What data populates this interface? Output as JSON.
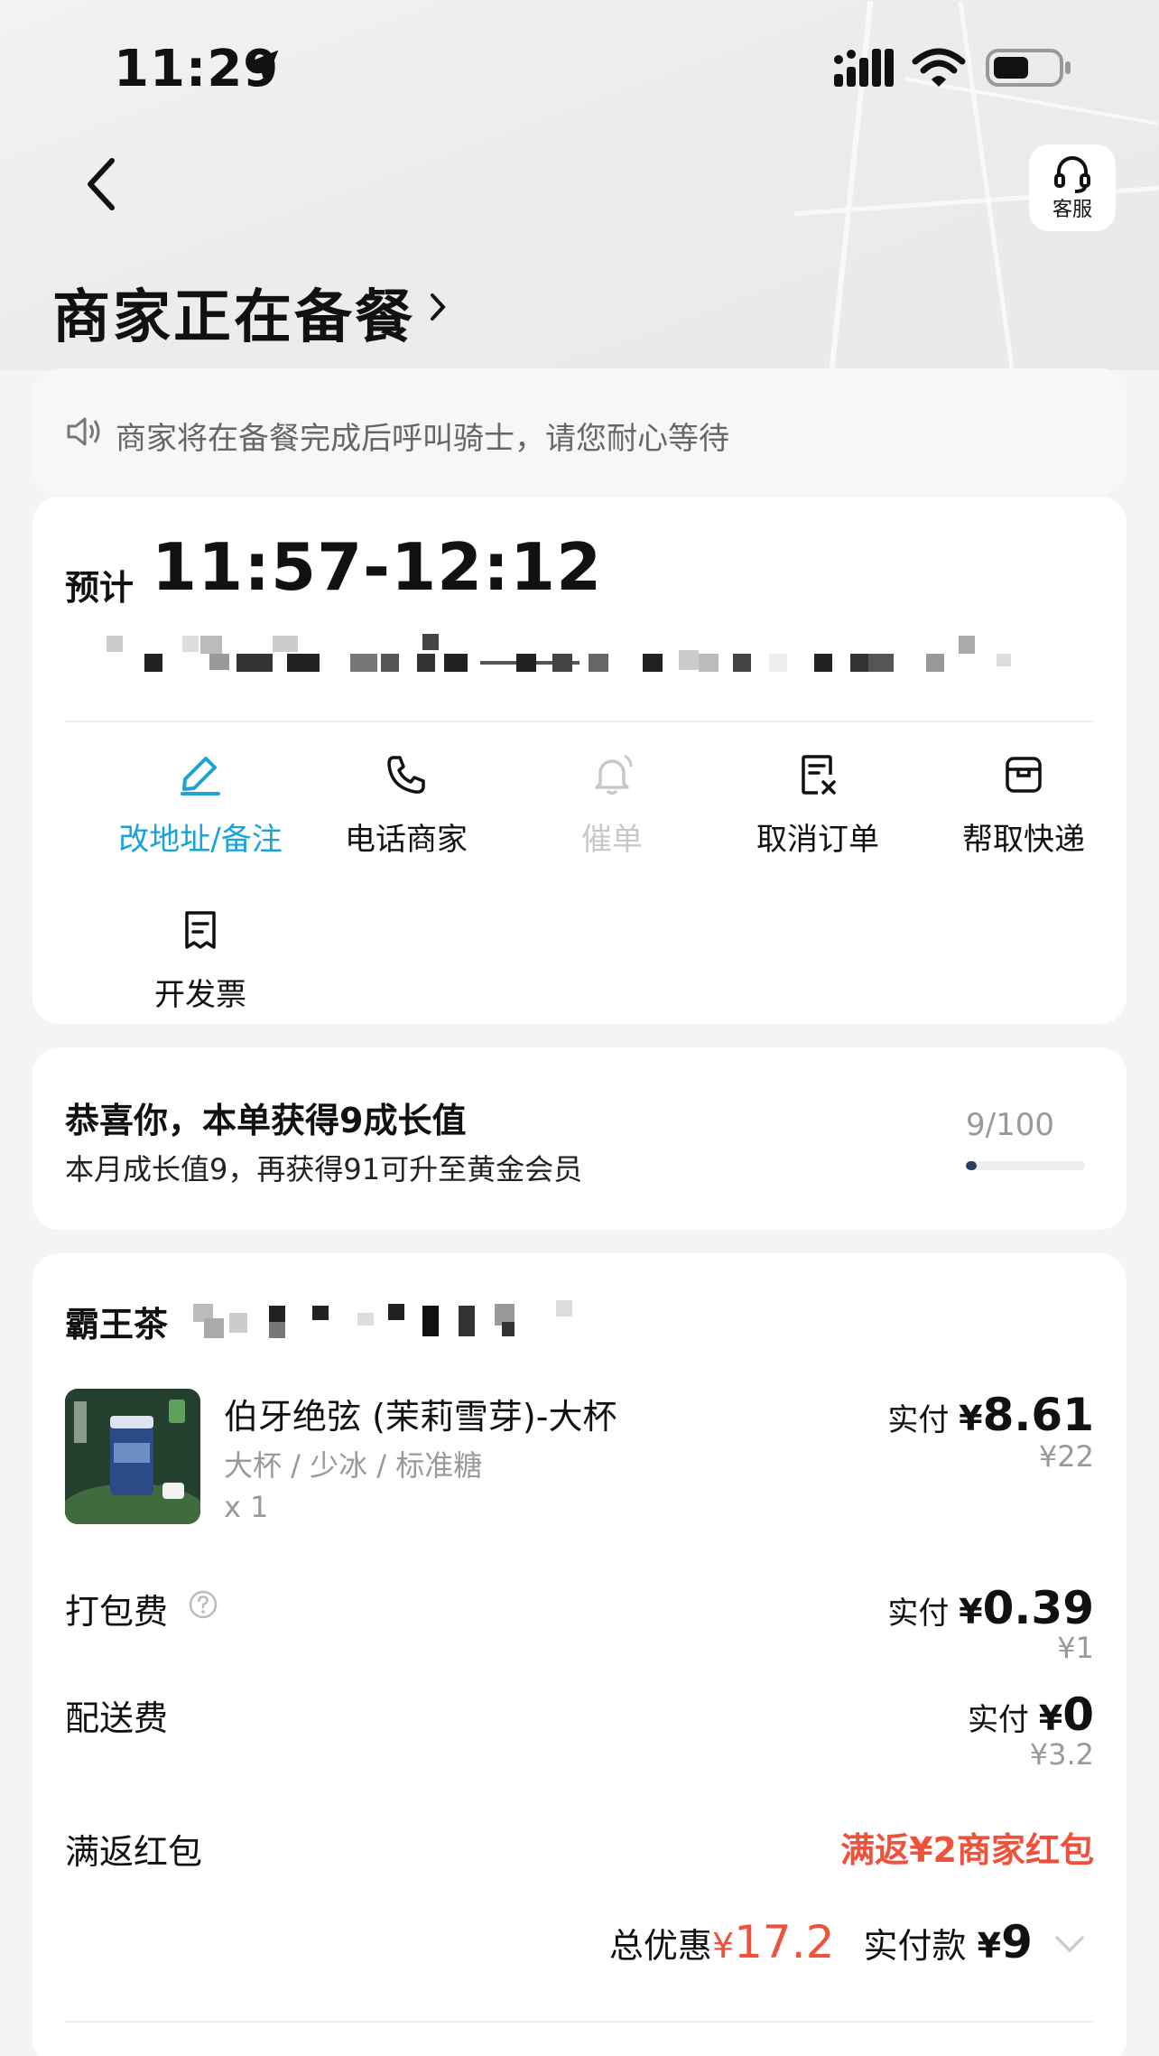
{
  "status_bar": {
    "time": "11:29"
  },
  "header": {
    "title": "商家正在备餐",
    "service_label": "客服"
  },
  "notice": {
    "text": "商家将在备餐完成后呼叫骑士，请您耐心等待"
  },
  "eta": {
    "label": "预计",
    "time": "11:57-12:12"
  },
  "actions": [
    {
      "label": "改地址/备注",
      "icon": "edit-pen-icon",
      "state": "active"
    },
    {
      "label": "电话商家",
      "icon": "phone-icon",
      "state": "normal"
    },
    {
      "label": "催单",
      "icon": "bell-icon",
      "state": "disabled"
    },
    {
      "label": "取消订单",
      "icon": "cancel-doc-icon",
      "state": "normal"
    },
    {
      "label": "帮取快递",
      "icon": "package-icon",
      "state": "normal"
    },
    {
      "label": "开发票",
      "icon": "receipt-icon",
      "state": "normal"
    }
  ],
  "growth": {
    "title": "恭喜你，本单获得9成长值",
    "subtitle": "本月成长值9，再获得91可升至黄金会员",
    "count": "9/100",
    "progress_fraction": 0.09
  },
  "order": {
    "shop_name": "霸王茶",
    "item": {
      "name": "伯牙绝弦 (茉莉雪芽)-大杯",
      "spec": "大杯 / 少冰 / 标准糖",
      "qty": "x 1",
      "paid_label": "实付",
      "paid_currency": "¥",
      "paid_amount": "8.61",
      "original": "¥22"
    },
    "packing": {
      "label": "打包费",
      "paid_label": "实付",
      "paid_currency": "¥",
      "paid_amount": "0.39",
      "original": "¥1"
    },
    "delivery": {
      "label": "配送费",
      "paid_label": "实付",
      "paid_currency": "¥",
      "paid_amount": "0",
      "original": "¥3.2"
    },
    "promo": {
      "label": "满返红包",
      "value": "满返¥2商家红包"
    },
    "summary": {
      "discount_label": "总优惠",
      "discount_currency": "¥",
      "discount_amount": "17.2",
      "paid_label": "实付款",
      "paid_currency": "¥",
      "paid_amount": "9"
    }
  },
  "colors": {
    "accent": "#1aa3d8",
    "discount_red": "#f0513a",
    "disabled": "#c8c8c8"
  }
}
